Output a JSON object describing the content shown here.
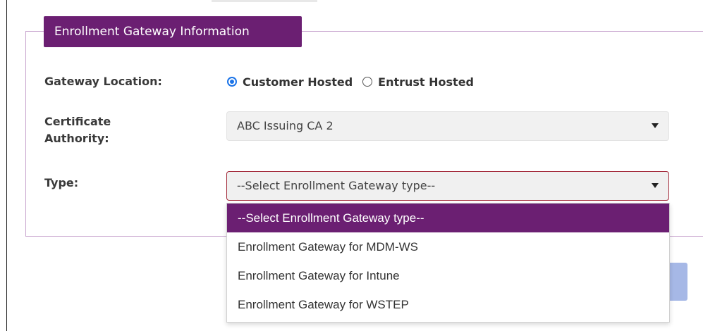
{
  "section": {
    "legend": "Enrollment Gateway Information"
  },
  "gateway_location": {
    "label": "Gateway Location:",
    "options": [
      {
        "label": "Customer Hosted",
        "checked": true
      },
      {
        "label": "Entrust Hosted",
        "checked": false
      }
    ]
  },
  "certificate_authority": {
    "label_line1": "Certificate",
    "label_line2": "Authority:",
    "value": "ABC Issuing CA 2"
  },
  "type": {
    "label": "Type:",
    "value": "--Select Enrollment Gateway type--",
    "options": [
      {
        "label": "--Select Enrollment Gateway type--",
        "selected": true
      },
      {
        "label": "Enrollment Gateway for MDM-WS",
        "selected": false
      },
      {
        "label": "Enrollment Gateway for Intune",
        "selected": false
      },
      {
        "label": "Enrollment Gateway for WSTEP",
        "selected": false
      }
    ]
  },
  "colors": {
    "accent": "#6b1f72",
    "radio": "#1a73e8",
    "active_border": "#a32a3a"
  }
}
